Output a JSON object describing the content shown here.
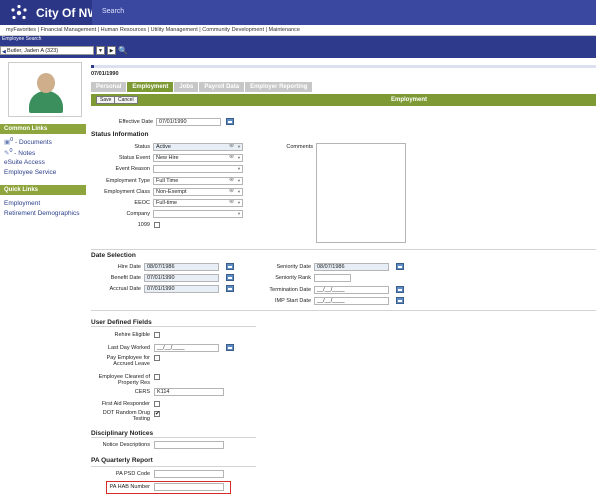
{
  "app": {
    "title": "City Of NWS",
    "search_placeholder": "Search"
  },
  "menu": {
    "items": [
      "myFavorites",
      "Financial Management",
      "Human Resources",
      "Utility Management",
      "Community Development",
      "Maintenance"
    ]
  },
  "employee_search": {
    "label": "Employee Search",
    "selected": "Butler, Jaden A (323)"
  },
  "nav": {
    "common_links_title": "Common Links",
    "common_links": [
      "Documents",
      "Notes",
      "eSuite Access",
      "Employee Service"
    ],
    "documents_badge": "0",
    "notes_badge": "0",
    "quick_links_title": "Quick Links",
    "quick_links": [
      "Employment",
      "Retirement Demographics"
    ]
  },
  "record": {
    "date": "07/01/1990"
  },
  "tabs": [
    "Personal",
    "Employment",
    "Jobs",
    "Payroll Data",
    "Employer Reporting"
  ],
  "actions": {
    "save": "Save",
    "cancel": "Cancel",
    "title": "Employment"
  },
  "effective": {
    "label": "Effective Date",
    "value": "07/01/1990"
  },
  "status_info": {
    "title": "Status Information",
    "status": {
      "label": "Status",
      "value": "Active"
    },
    "status_event": {
      "label": "Status Event",
      "value": "New Hire"
    },
    "event_reason": {
      "label": "Event Reason",
      "value": ""
    },
    "employment_type": {
      "label": "Employment Type",
      "value": "Full Time"
    },
    "employment_class": {
      "label": "Employment Class",
      "value": "Non-Exempt"
    },
    "eeoc": {
      "label": "EEOC",
      "value": "Full-time"
    },
    "company": {
      "label": "Company",
      "value": ""
    },
    "f1099": {
      "label": "1099",
      "checked": false
    },
    "comments_label": "Comments"
  },
  "date_selection": {
    "title": "Date Selection",
    "hire_date": {
      "label": "Hire Date",
      "value": "08/07/1986"
    },
    "benefit_date": {
      "label": "Benefit Date",
      "value": "07/01/1990"
    },
    "accrual_date": {
      "label": "Accrual Date",
      "value": "07/01/1990"
    },
    "seniority_date": {
      "label": "Seniority Date",
      "value": "08/07/1986"
    },
    "seniority_rank": {
      "label": "Seniority Rank",
      "value": ""
    },
    "termination_date": {
      "label": "Termination Date",
      "value": "__/__/____"
    },
    "imp_start_date": {
      "label": "IMP Start Date",
      "value": "__/__/____"
    }
  },
  "user_defined": {
    "title": "User Defined Fields",
    "rehire_eligible": {
      "label": "Rehire Eligible",
      "checked": false
    },
    "last_day_worked": {
      "label": "Last Day Worked",
      "value": "__/__/____"
    },
    "pay_accrued": {
      "label": "Pay Employee for Accrued Leave",
      "checked": false
    },
    "cleared_property": {
      "label": "Employee Cleared of Property Res",
      "checked": false
    },
    "cers": {
      "label": "CERS",
      "value": "K114"
    },
    "first_aid": {
      "label": "First Aid Responder",
      "checked": false
    },
    "dot_drug": {
      "label": "DOT Random Drug Testing",
      "checked": true
    }
  },
  "disciplinary": {
    "title": "Disciplinary Notices",
    "descriptions": {
      "label": "Notice Descriptions",
      "value": ""
    }
  },
  "pa_quarterly": {
    "title": "PA Quarterly Report",
    "psd_code": {
      "label": "PA PSD Code",
      "value": ""
    },
    "hab_number": {
      "label": "PA HAB Number",
      "value": ""
    }
  }
}
